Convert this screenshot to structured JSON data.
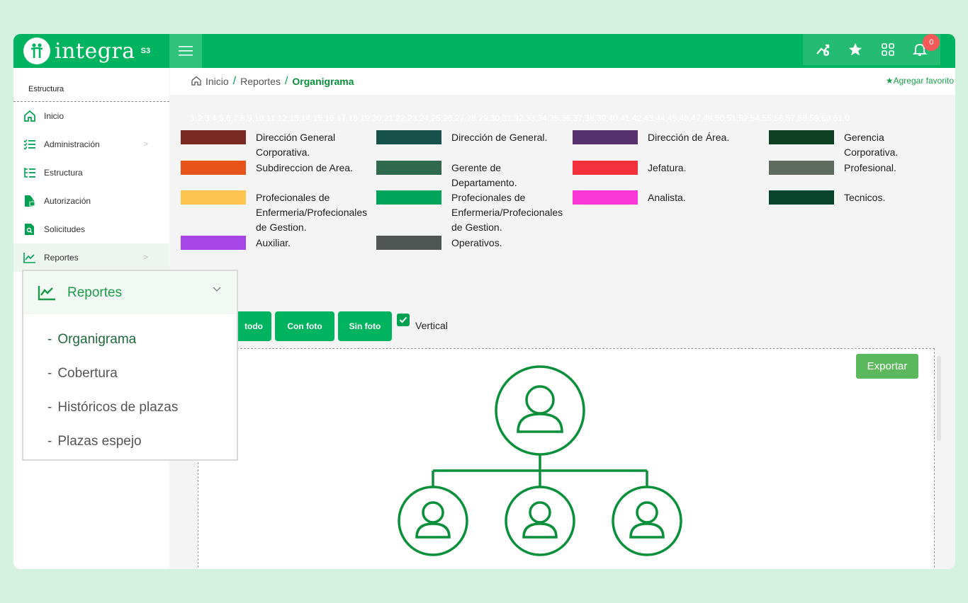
{
  "brand": {
    "name": "integra",
    "suffix": "S3",
    "color": "#00b35e"
  },
  "topbar": {
    "icons": [
      "chart-settings-icon",
      "star-icon",
      "apps-grid-icon",
      "bell-icon"
    ],
    "notification_count": "0"
  },
  "sidebar": {
    "header": "Estructura",
    "items": [
      {
        "label": "Inicio",
        "icon": "home-icon"
      },
      {
        "label": "Administración",
        "icon": "list-check-icon",
        "chevron": ">"
      },
      {
        "label": "Estructura",
        "icon": "structure-list-icon"
      },
      {
        "label": "Autorización",
        "icon": "document-lock-icon"
      },
      {
        "label": "Solicitudes",
        "icon": "document-search-icon"
      },
      {
        "label": "Reportes",
        "icon": "chart-line-icon",
        "chevron": ">"
      }
    ]
  },
  "breadcrumb": {
    "home": "Inicio",
    "sep": "/",
    "section": "Reportes",
    "current": "Organigrama",
    "favorite": "★Agregar favorito"
  },
  "numbers_strip": "1,2,3,4,5,6,7,8,9,10,11,12,13,14,15,16,17,18,19,20,21,22,23,24,25,26,27,28,29,30,31,32,33,34,35,36,37,38,39,40,41,42,43,44,45,46,47,49,50,51,52,54,55,56,57,58,59,60,61,0",
  "legend": [
    {
      "label": "Dirección General Corporativa.",
      "color": "#7a2a22"
    },
    {
      "label": "Dirección de General.",
      "color": "#17524a"
    },
    {
      "label": "Dirección de Área.",
      "color": "#57306e"
    },
    {
      "label": "Gerencia Corporativa.",
      "color": "#0d3f22"
    },
    {
      "label": "Subdireccion de Area.",
      "color": "#e6541a"
    },
    {
      "label": "Gerente de Departamento.",
      "color": "#2f6a4e"
    },
    {
      "label": "Jefatura.",
      "color": "#f2313c"
    },
    {
      "label": "Profesional.",
      "color": "#5f6b5f"
    },
    {
      "label": "Profecionales de Enfermeria/Profecionales de Gestion.",
      "color": "#fdc44f"
    },
    {
      "label": "Profecionales de Enfermeria/Profecionales de Gestion.",
      "color": "#00a55a"
    },
    {
      "label": "Analista.",
      "color": "#fa37d5"
    },
    {
      "label": "Tecnicos.",
      "color": "#07432d"
    },
    {
      "label": "Auxiliar.",
      "color": "#a646e6"
    },
    {
      "label": "Operativos.",
      "color": "#4f5654"
    }
  ],
  "controls": {
    "btn_all": "todo",
    "btn_with_photo": "Con foto",
    "btn_without_photo": "Sin foto",
    "vertical_label": "Vertical",
    "vertical_checked": true,
    "export": "Exportar"
  },
  "popup": {
    "title": "Reportes",
    "items": [
      {
        "label": "Organigrama"
      },
      {
        "label": "Cobertura"
      },
      {
        "label": "Históricos de plazas"
      },
      {
        "label": "Plazas espejo"
      }
    ]
  }
}
